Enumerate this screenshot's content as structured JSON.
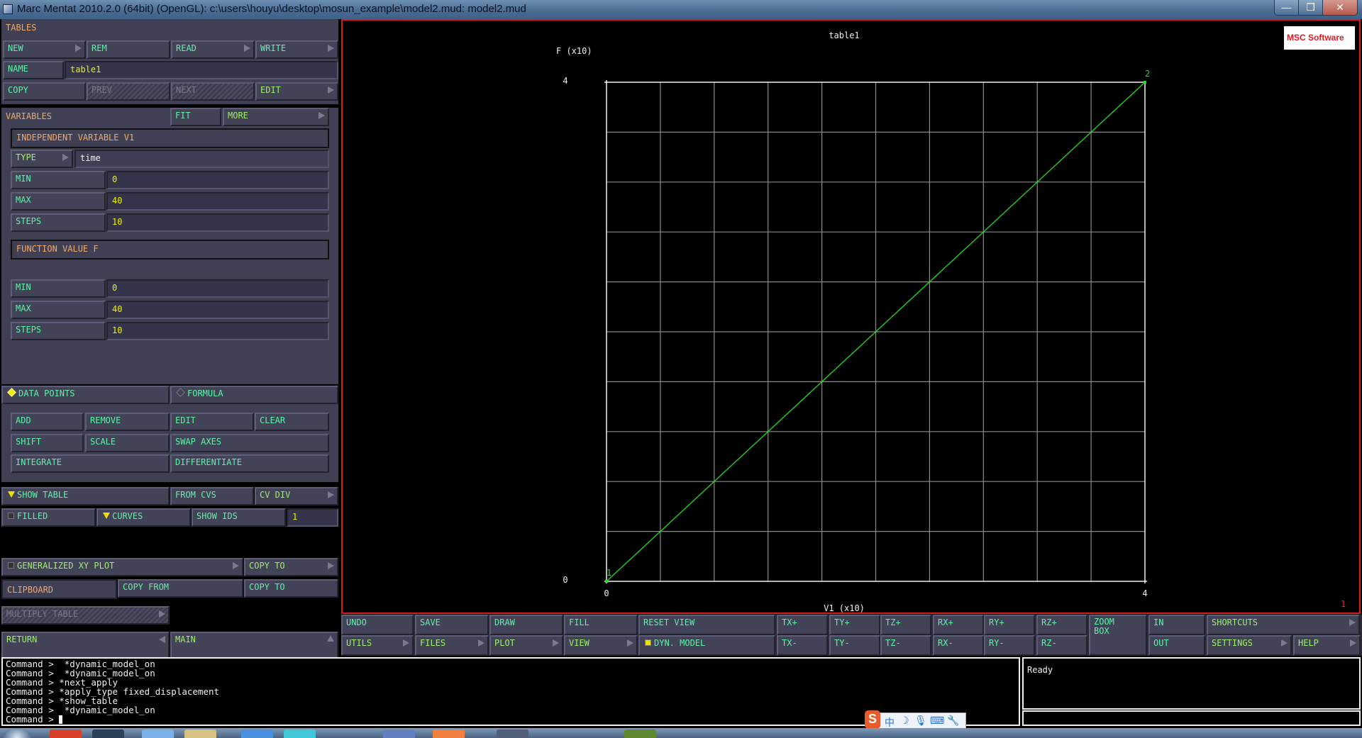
{
  "window": {
    "title": "Marc Mentat 2010.2.0 (64bit) (OpenGL): c:\\users\\houyu\\desktop\\mosun_example\\model2.mud: model2.mud",
    "minimize": "—",
    "restore": "❐",
    "close": "✕"
  },
  "tables": {
    "heading": "TABLES",
    "new": "NEW",
    "rem": "REM",
    "read": "READ",
    "write": "WRITE",
    "name_label": "NAME",
    "name_value": "table1",
    "copy": "COPY",
    "prev": "PREV",
    "next": "NEXT",
    "edit": "EDIT"
  },
  "variables": {
    "heading": "VARIABLES",
    "fit": "FIT",
    "more": "MORE",
    "independent": {
      "heading": "INDEPENDENT VARIABLE V1",
      "type_label": "TYPE",
      "type_value": "time",
      "min_label": "MIN",
      "min_value": "0",
      "max_label": "MAX",
      "max_value": "40",
      "steps_label": "STEPS",
      "steps_value": "10"
    },
    "function": {
      "heading": "FUNCTION VALUE F",
      "min_label": "MIN",
      "min_value": "0",
      "max_label": "MAX",
      "max_value": "40",
      "steps_label": "STEPS",
      "steps_value": "10"
    }
  },
  "mode": {
    "data_points": "DATA POINTS",
    "data_points_selected": true,
    "formula": "FORMULA",
    "formula_selected": false
  },
  "ops": {
    "add": "ADD",
    "remove": "REMOVE",
    "edit": "EDIT",
    "clear": "CLEAR",
    "shift": "SHIFT",
    "scale": "SCALE",
    "swap_axes": "SWAP AXES",
    "integrate": "INTEGRATE",
    "differentiate": "DIFFERENTIATE"
  },
  "display": {
    "show_table": "SHOW TABLE",
    "from_cvs": "FROM CVS",
    "cv_div": "CV DIV",
    "filled": "FILLED",
    "curves": "CURVES",
    "show_ids": "SHOW IDS",
    "show_ids_value": "1"
  },
  "misc": {
    "generalized_xy_plot": "GENERALIZED XY PLOT",
    "copy_to_1": "COPY TO",
    "clipboard": "CLIPBOARD",
    "copy_from": "COPY FROM",
    "copy_to_2": "COPY TO",
    "multiply_table": "MULTIPLY TABLE",
    "return": "RETURN",
    "main": "MAIN"
  },
  "viewport": {
    "logo": "MSC Software",
    "view_number": "1"
  },
  "chart_data": {
    "type": "line",
    "title": "table1",
    "xlabel": "V1 (x10)",
    "ylabel": "F (x10)",
    "xlim": [
      0,
      4
    ],
    "ylim": [
      0,
      4
    ],
    "x_ticks": [
      "0",
      "4"
    ],
    "y_ticks": [
      "0",
      "4"
    ],
    "grid": true,
    "grid_divisions": 10,
    "series": [
      {
        "name": "table1",
        "color": "#22dd22",
        "x": [
          0,
          4
        ],
        "y": [
          0,
          4
        ],
        "point_ids": [
          "1",
          "2"
        ]
      }
    ]
  },
  "toolbar": {
    "row1": [
      "UNDO",
      "SAVE",
      "DRAW",
      "FILL",
      "RESET VIEW",
      "TX+",
      "TY+",
      "TZ+",
      "RX+",
      "RY+",
      "RZ+",
      "ZOOM BOX",
      "IN",
      "SHORTCUTS"
    ],
    "row2": [
      "UTILS",
      "FILES",
      "PLOT",
      "VIEW",
      "DYN. MODEL",
      "TX-",
      "TY-",
      "TZ-",
      "RX-",
      "RY-",
      "RZ-",
      "OUT",
      "SETTINGS",
      "HELP"
    ]
  },
  "command": {
    "history": [
      "Command >  *dynamic_model_on",
      "Command >  *dynamic_model_on",
      "Command > *next_apply",
      "Command > *apply_type fixed_displacement",
      "Command > *show_table",
      "Command >  *dynamic_model_on"
    ],
    "prompt": "Command > "
  },
  "status": {
    "text": "Ready"
  },
  "ime": {
    "logo": "S",
    "lang": "中"
  },
  "colors": {
    "panel": "#404055",
    "button_text": "#5ef2a8",
    "value_text": "#f0f000",
    "heading_text": "#f0a868",
    "viewport_border": "#e01818",
    "curve": "#22dd22"
  }
}
